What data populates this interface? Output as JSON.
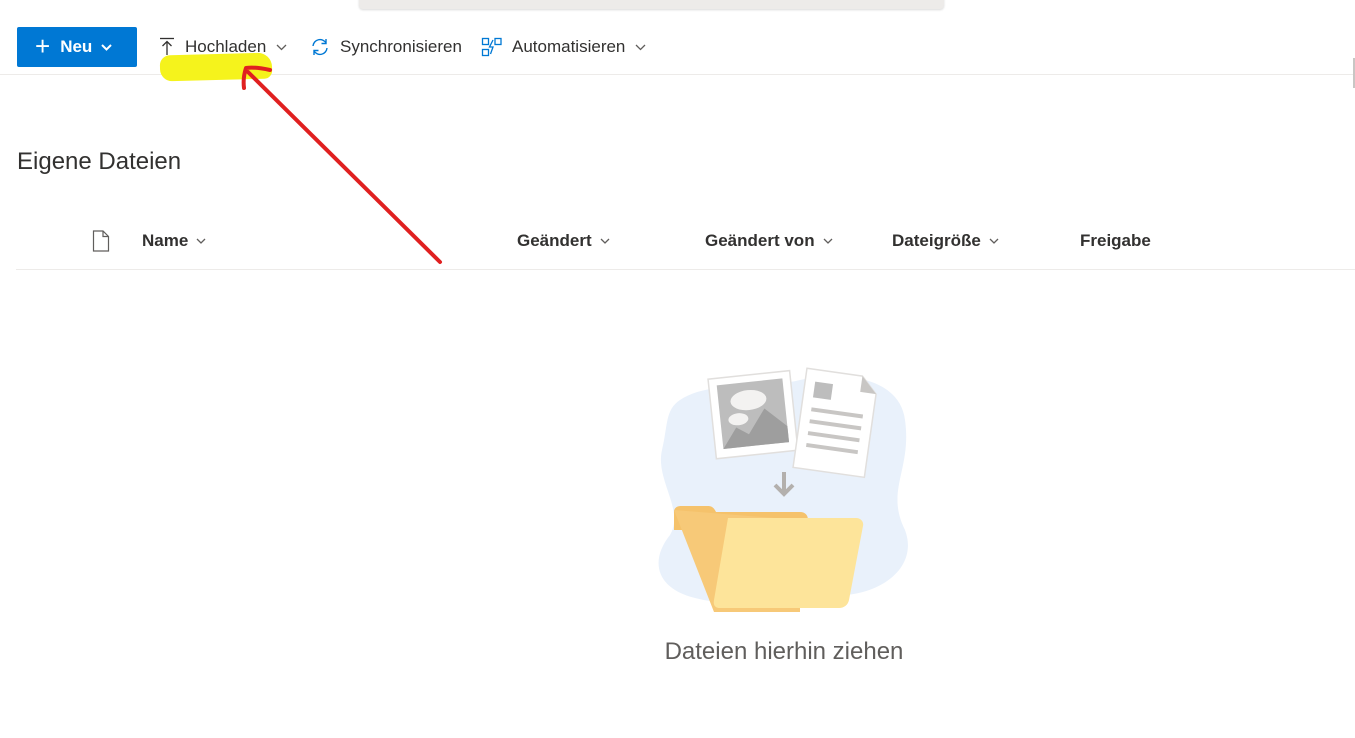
{
  "commandbar": {
    "new_label": "Neu",
    "upload_label": "Hochladen",
    "sync_label": "Synchronisieren",
    "automate_label": "Automatisieren"
  },
  "page_title": "Eigene Dateien",
  "columns": {
    "name": "Name",
    "modified": "Geändert",
    "modified_by": "Geändert von",
    "file_size": "Dateigröße",
    "sharing": "Freigabe"
  },
  "empty_state": {
    "message": "Dateien hierhin ziehen"
  },
  "icons": {
    "plus": "plus-icon",
    "upload": "upload-icon",
    "sync": "sync-icon",
    "automate": "automate-icon",
    "file_type": "document-icon",
    "chevron": "chevron-down-icon"
  },
  "colors": {
    "primary": "#0078d4",
    "highlight": "#f5f31c",
    "annotation": "#e02020",
    "folder": "#fde49a",
    "text": "#323130"
  }
}
